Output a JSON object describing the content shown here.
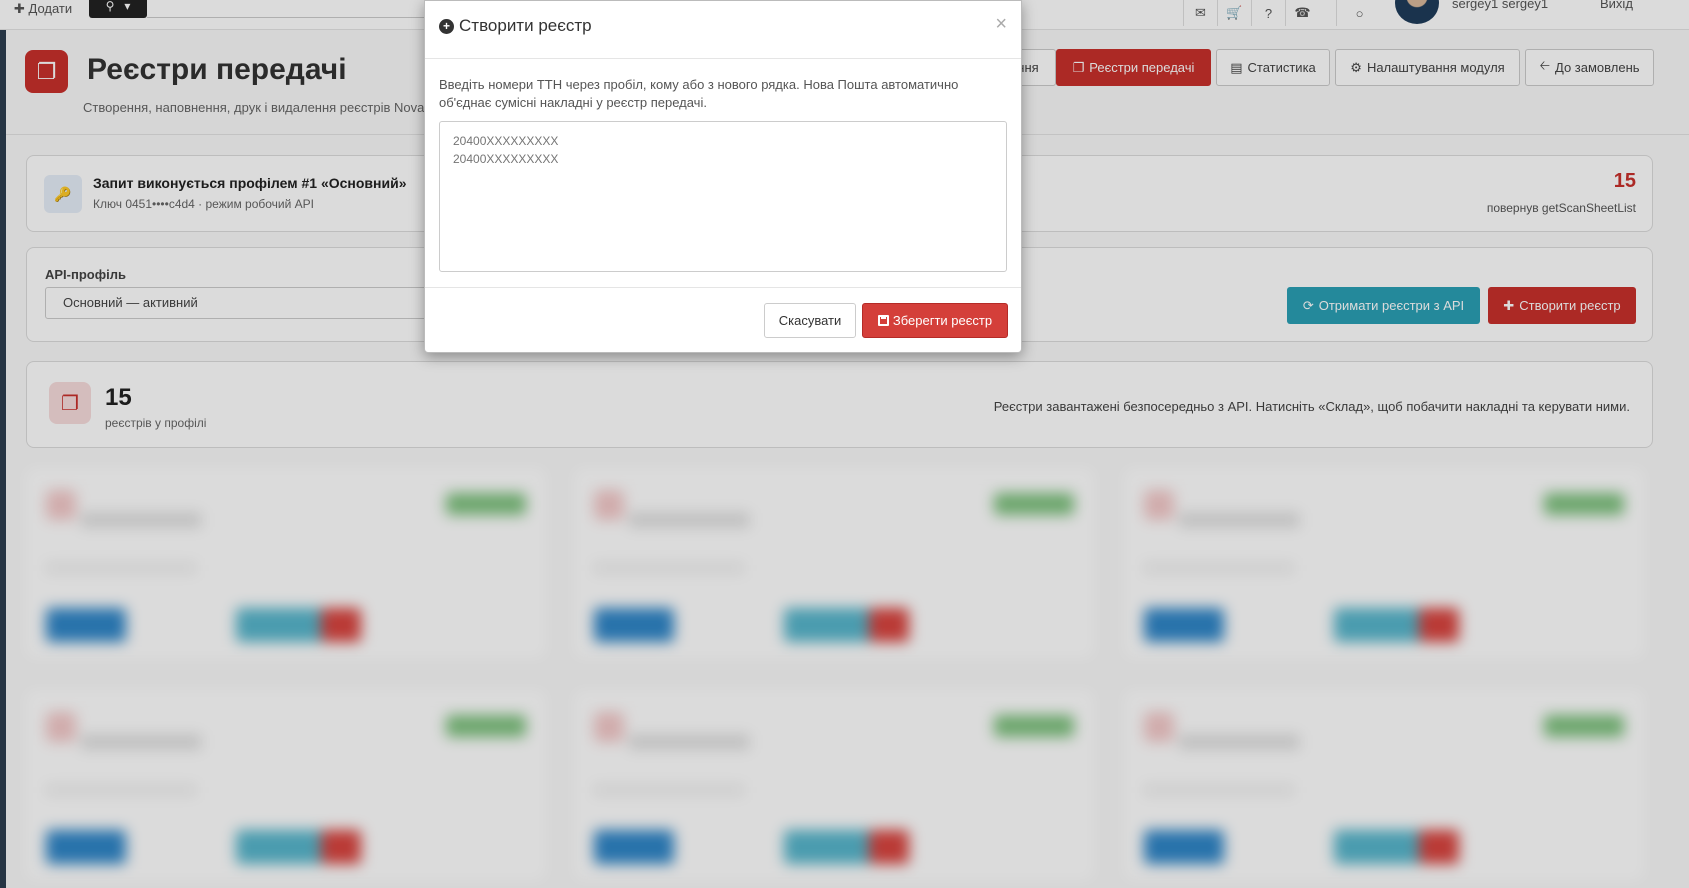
{
  "topbar": {
    "add_label": "✚ Додати",
    "user_name": "sergey1 sergey1",
    "logout_label": "Вихід",
    "icons": [
      "comment-icon",
      "cart-icon",
      "help-icon",
      "phone-icon",
      "chat-icon"
    ]
  },
  "header": {
    "title": "Реєстри передачі",
    "subtitle": "Створення, наповнення, друк і видалення реєстрів Nova Пошти",
    "nav": {
      "partial_label": "ння",
      "registries_label": "Реєстри передачі",
      "stats_label": "Статистика",
      "settings_label": "Налаштування модуля",
      "orders_label": "До замовлень"
    }
  },
  "profile_info": {
    "title": "Запит виконується профілем #1 «Основний»",
    "subtitle": "Ключ 0451••••c4d4 · режим робочий API",
    "count": "15",
    "note": "повернув getScanSheetList"
  },
  "api_profile": {
    "label": "API-профіль",
    "selected": "Основний — активний",
    "fetch_button": "Отримати реєстри з API",
    "create_button": "Створити реєстр"
  },
  "stats": {
    "count": "15",
    "label": "реєстрів у профілі",
    "note": "Реєстри завантажені безпосередньо з API. Натисніть «Склад», щоб побачити накладні та керувати ними."
  },
  "modal": {
    "title": "Створити реєстр",
    "close": "×",
    "help": "Введіть номери ТТН через пробіл, кому або з нового рядка. Нова Пошта автоматично об'єднає сумісні накладні у реєстр передачі.",
    "placeholder": "20400XXXXXXXXX\n20400XXXXXXXXX",
    "cancel_label": "Скасувати",
    "save_label": "Зберегти реєстр"
  },
  "colors": {
    "danger": "#c9302c",
    "info": "#2aa0b5",
    "primary": "#2f86c8",
    "success": "#7ec27e"
  }
}
